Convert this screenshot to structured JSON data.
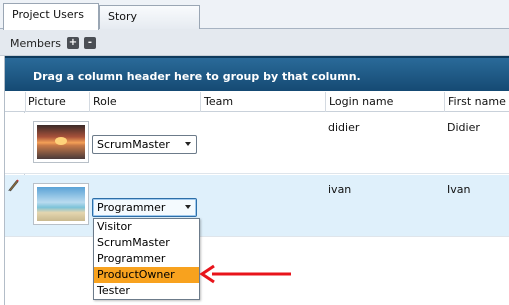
{
  "tabs": [
    {
      "label": "Project Users",
      "active": true
    },
    {
      "label": "Story Templates",
      "active": false
    }
  ],
  "toolbar": {
    "members_label": "Members",
    "add_symbol": "+",
    "remove_symbol": "-"
  },
  "grid": {
    "group_panel_text": "Drag a column header here to group by that column.",
    "columns": [
      "Picture",
      "Role",
      "Team",
      "Login name",
      "First name"
    ],
    "rows": [
      {
        "picture": "sunset-photo",
        "role": "ScrumMaster",
        "team": "",
        "login": "didier",
        "first_name": "Didier"
      },
      {
        "picture": "beach-photo",
        "role": "Programmer",
        "team": "",
        "login": "ivan",
        "first_name": "Ivan"
      }
    ]
  },
  "role_dropdown": {
    "options": [
      "Visitor",
      "ScrumMaster",
      "Programmer",
      "ProductOwner",
      "Tester"
    ],
    "highlighted": "ProductOwner"
  },
  "colors": {
    "group_panel": "#1d5a86",
    "selected_row": "#dff0fb",
    "highlight": "#f8a21e",
    "annotation_arrow": "#e8141b"
  }
}
